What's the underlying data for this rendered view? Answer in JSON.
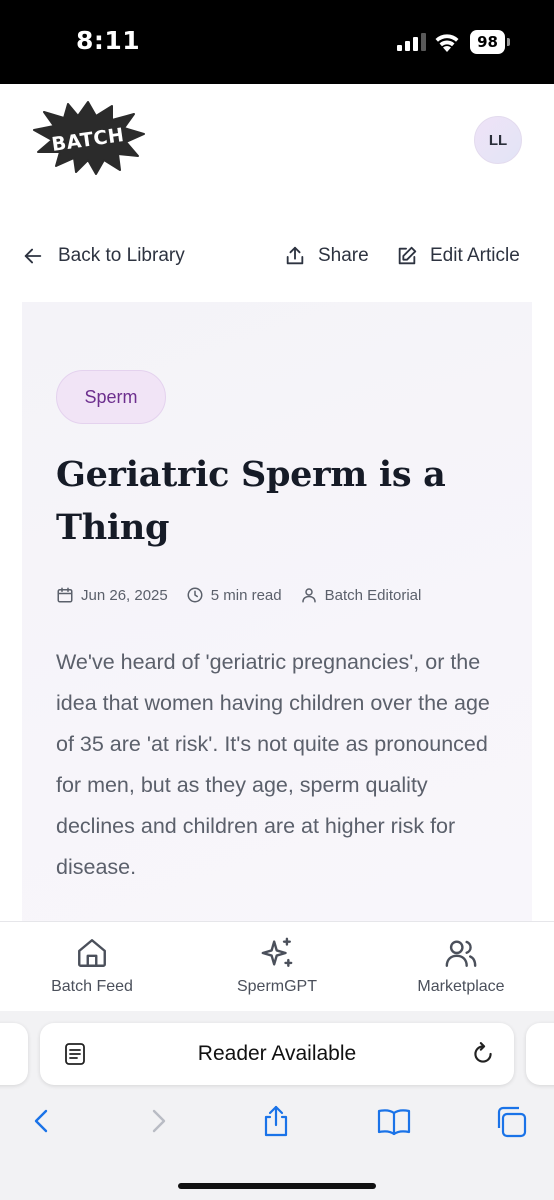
{
  "status_bar": {
    "time": "8:11",
    "battery": "98"
  },
  "header": {
    "logo_text": "BATCH",
    "avatar_initials": "LL"
  },
  "toolbar": {
    "back_label": "Back to Library",
    "share_label": "Share",
    "edit_label": "Edit Article"
  },
  "article": {
    "tag": "Sperm",
    "title": "Geriatric Sperm is a Thing",
    "date": "Jun 26, 2025",
    "read_time": "5 min read",
    "author": "Batch Editorial",
    "excerpt": "We've heard of 'geriatric pregnancies', or the idea that women having children over the age of 35 are 'at risk'. It's not quite as pronounced for men, but as they age, sperm quality declines and children are at higher risk for disease."
  },
  "bottom_nav": {
    "items": [
      {
        "label": "Batch Feed",
        "icon": "home-icon"
      },
      {
        "label": "SpermGPT",
        "icon": "sparkles-icon"
      },
      {
        "label": "Marketplace",
        "icon": "users-icon"
      }
    ]
  },
  "browser": {
    "reader_label": "Reader Available"
  },
  "colors": {
    "accent": "#6d2f8e",
    "tag_bg": "#f1e4f6",
    "ios_blue": "#1a73e8"
  }
}
